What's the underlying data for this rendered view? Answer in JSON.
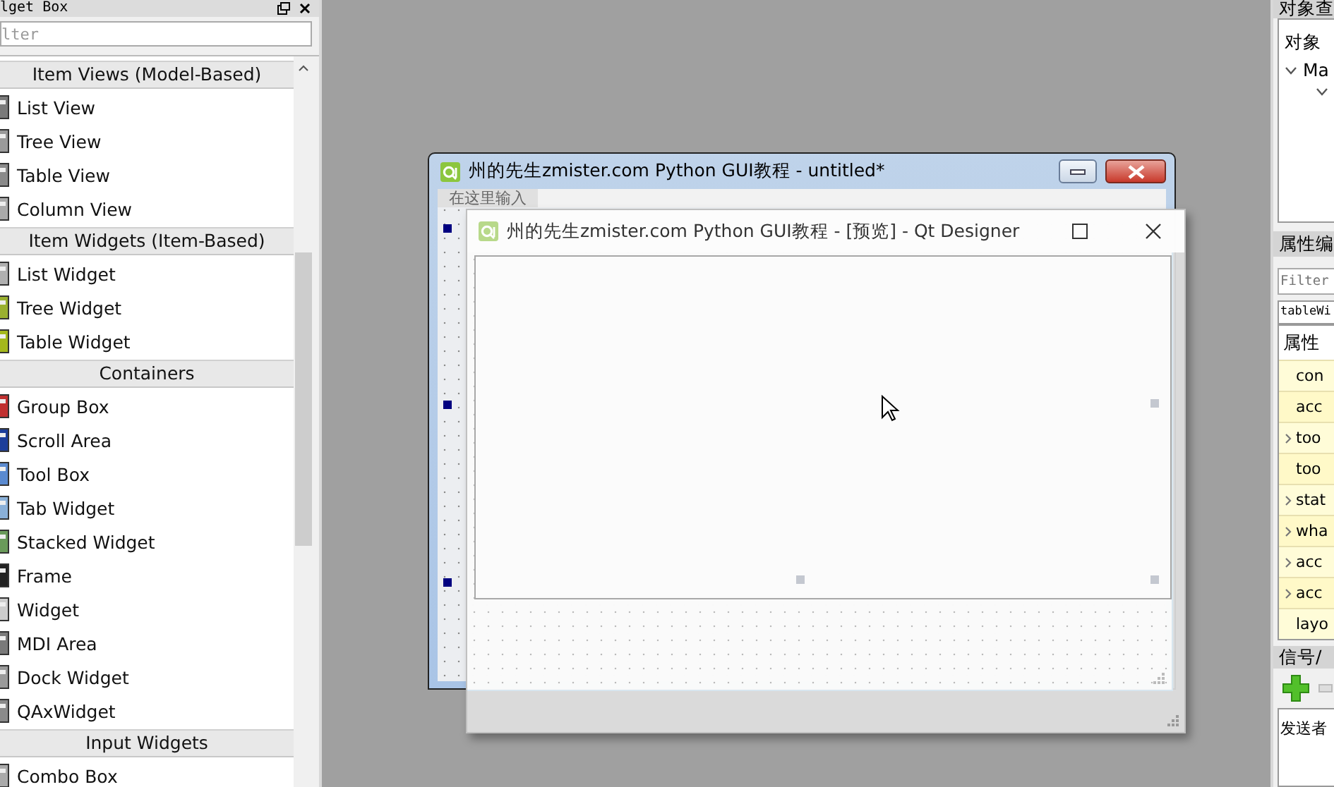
{
  "widget_box": {
    "title": "lget Box",
    "filter": {
      "placeholder": "lter"
    },
    "groups": [
      {
        "name": "Item Views (Model-Based)",
        "items": [
          "List View",
          "Tree View",
          "Table View",
          "Column View"
        ]
      },
      {
        "name": "Item Widgets (Item-Based)",
        "items": [
          "List Widget",
          "Tree Widget",
          "Table Widget"
        ]
      },
      {
        "name": "Containers",
        "items": [
          "Group Box",
          "Scroll Area",
          "Tool Box",
          "Tab Widget",
          "Stacked Widget",
          "Frame",
          "Widget",
          "MDI Area",
          "Dock Widget",
          "QAxWidget"
        ]
      },
      {
        "name": "Input Widgets",
        "items": [
          "Combo Box"
        ]
      }
    ]
  },
  "form_window": {
    "title": "州的先生zmister.com Python GUI教程 - untitled*",
    "menu_placeholder": "在这里输入"
  },
  "preview_window": {
    "title": "州的先生zmister.com Python GUI教程 - [预览] - Qt Designer"
  },
  "object_inspector": {
    "title": "对象查",
    "column": "对象",
    "tree": [
      {
        "label": "Ma",
        "expanded": true
      }
    ]
  },
  "property_editor": {
    "title": "属性编",
    "filter": {
      "placeholder": "Filter"
    },
    "object_name": "tableWi",
    "header": "属性",
    "rows": [
      {
        "name": "con",
        "expandable": false
      },
      {
        "name": "acc",
        "expandable": false
      },
      {
        "name": "too",
        "expandable": true
      },
      {
        "name": "too",
        "expandable": false
      },
      {
        "name": "stat",
        "expandable": true
      },
      {
        "name": "wha",
        "expandable": true
      },
      {
        "name": "acc",
        "expandable": true
      },
      {
        "name": "acc",
        "expandable": true
      },
      {
        "name": "layo",
        "expandable": false
      }
    ]
  },
  "signal_slot": {
    "title": "信号/",
    "header": "发送者"
  }
}
